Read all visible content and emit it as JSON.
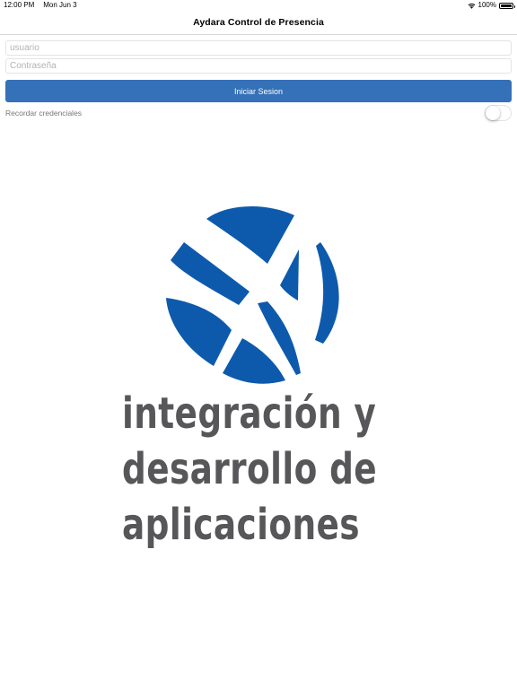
{
  "status_bar": {
    "time": "12:00 PM",
    "date": "Mon Jun 3",
    "battery": "100%",
    "icons": [
      "wifi-icon",
      "battery-icon"
    ]
  },
  "nav": {
    "title": "Aydara Control de Presencia"
  },
  "form": {
    "user_placeholder": "usuario",
    "password_placeholder": "Contraseña",
    "login_label": "Iniciar Sesion",
    "remember_label": "Recordar credenciales",
    "remember_on": false
  },
  "logo": {
    "icon": "globe-logo-icon",
    "line1": "integración y",
    "line2": "desarrollo de",
    "line3": "aplicaciones"
  },
  "colors": {
    "button": "#3571b8",
    "logo_blue": "#0d5aad",
    "logo_text": "#57575a"
  }
}
